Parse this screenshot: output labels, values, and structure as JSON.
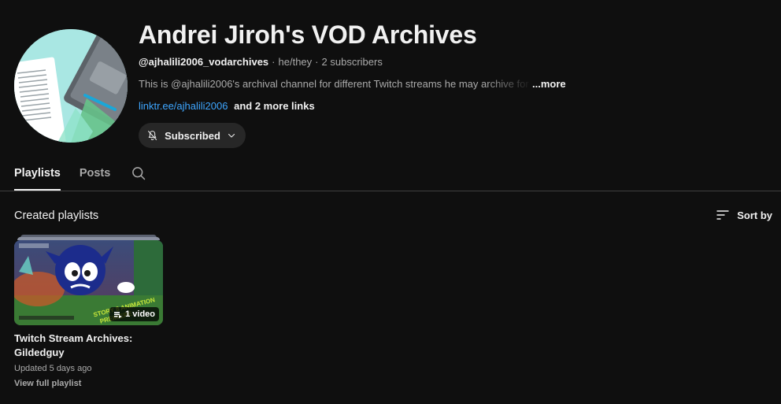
{
  "channel": {
    "title": "Andrei Jiroh's VOD Archives",
    "handle": "@ajhalili2006_vodarchives",
    "pronouns": "he/they",
    "subscribers": "2 subscribers",
    "description": "This is @ajhalili2006's archival channel for different Twitch streams he may archive for fu",
    "more_label": "...more",
    "link_main": "linktr.ee/ajhalili2006",
    "link_more": "and 2 more links",
    "subscribe_label": "Subscribed",
    "subscribe_icon": "bell-off-icon"
  },
  "tabs": [
    {
      "label": "Playlists",
      "active": true
    },
    {
      "label": "Posts",
      "active": false
    }
  ],
  "section": {
    "title": "Created playlists",
    "sort_label": "Sort by"
  },
  "playlists": [
    {
      "title": "Twitch Stream Archives: Gildedguy",
      "video_count": "1 video",
      "updated": "Updated 5 days ago",
      "view_full": "View full playlist"
    }
  ],
  "colors": {
    "background": "#0f0f0f",
    "text_primary": "#f1f1f1",
    "text_secondary": "#aaaaaa",
    "link": "#3ea6ff",
    "button_bg": "#272727",
    "divider": "#3f3f3f"
  }
}
